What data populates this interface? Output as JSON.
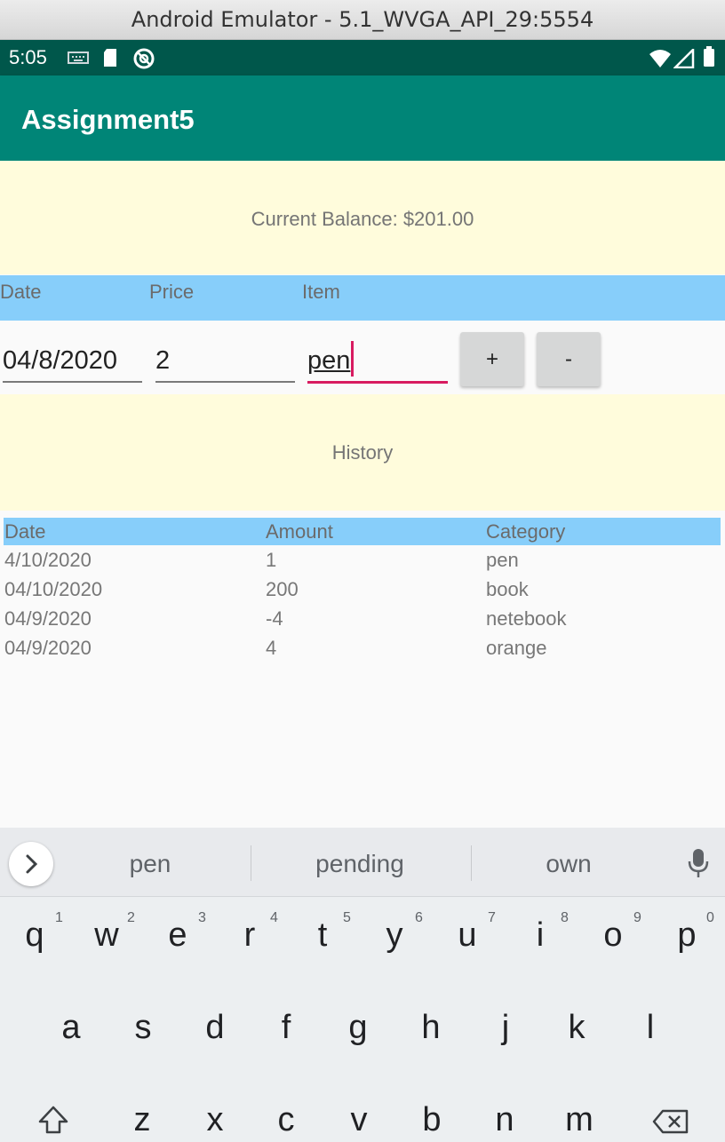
{
  "window": {
    "title": "Android Emulator - 5.1_WVGA_API_29:5554"
  },
  "status_bar": {
    "time": "5:05"
  },
  "app": {
    "title": "Assignment5"
  },
  "balance": {
    "text": "Current Balance: $201.00"
  },
  "input_header": {
    "date": "Date",
    "price": "Price",
    "item": "Item"
  },
  "inputs": {
    "date_value": "04/8/2020",
    "price_value": "2",
    "item_value": "pen"
  },
  "buttons": {
    "add": "+",
    "subtract": "-"
  },
  "history": {
    "title": "History"
  },
  "table": {
    "headers": {
      "date": "Date",
      "amount": "Amount",
      "category": "Category"
    },
    "rows": [
      {
        "date": "4/10/2020",
        "amount": "1",
        "category": "pen"
      },
      {
        "date": "04/10/2020",
        "amount": "200",
        "category": "book"
      },
      {
        "date": "04/9/2020",
        "amount": "-4",
        "category": "netebook"
      },
      {
        "date": "04/9/2020",
        "amount": "4",
        "category": "orange"
      }
    ]
  },
  "keyboard": {
    "suggestions": [
      "pen",
      "pending",
      "own"
    ],
    "row1": [
      {
        "key": "q",
        "hint": "1"
      },
      {
        "key": "w",
        "hint": "2"
      },
      {
        "key": "e",
        "hint": "3"
      },
      {
        "key": "r",
        "hint": "4"
      },
      {
        "key": "t",
        "hint": "5"
      },
      {
        "key": "y",
        "hint": "6"
      },
      {
        "key": "u",
        "hint": "7"
      },
      {
        "key": "i",
        "hint": "8"
      },
      {
        "key": "o",
        "hint": "9"
      },
      {
        "key": "p",
        "hint": "0"
      }
    ],
    "row2": [
      "a",
      "s",
      "d",
      "f",
      "g",
      "h",
      "j",
      "k",
      "l"
    ],
    "row3": [
      "z",
      "x",
      "c",
      "v",
      "b",
      "n",
      "m"
    ]
  },
  "colors": {
    "status_bar": "#00574b",
    "app_bar": "#008577",
    "panel_yellow": "#fffcdc",
    "header_blue": "#87cefa",
    "accent": "#d81b60"
  }
}
